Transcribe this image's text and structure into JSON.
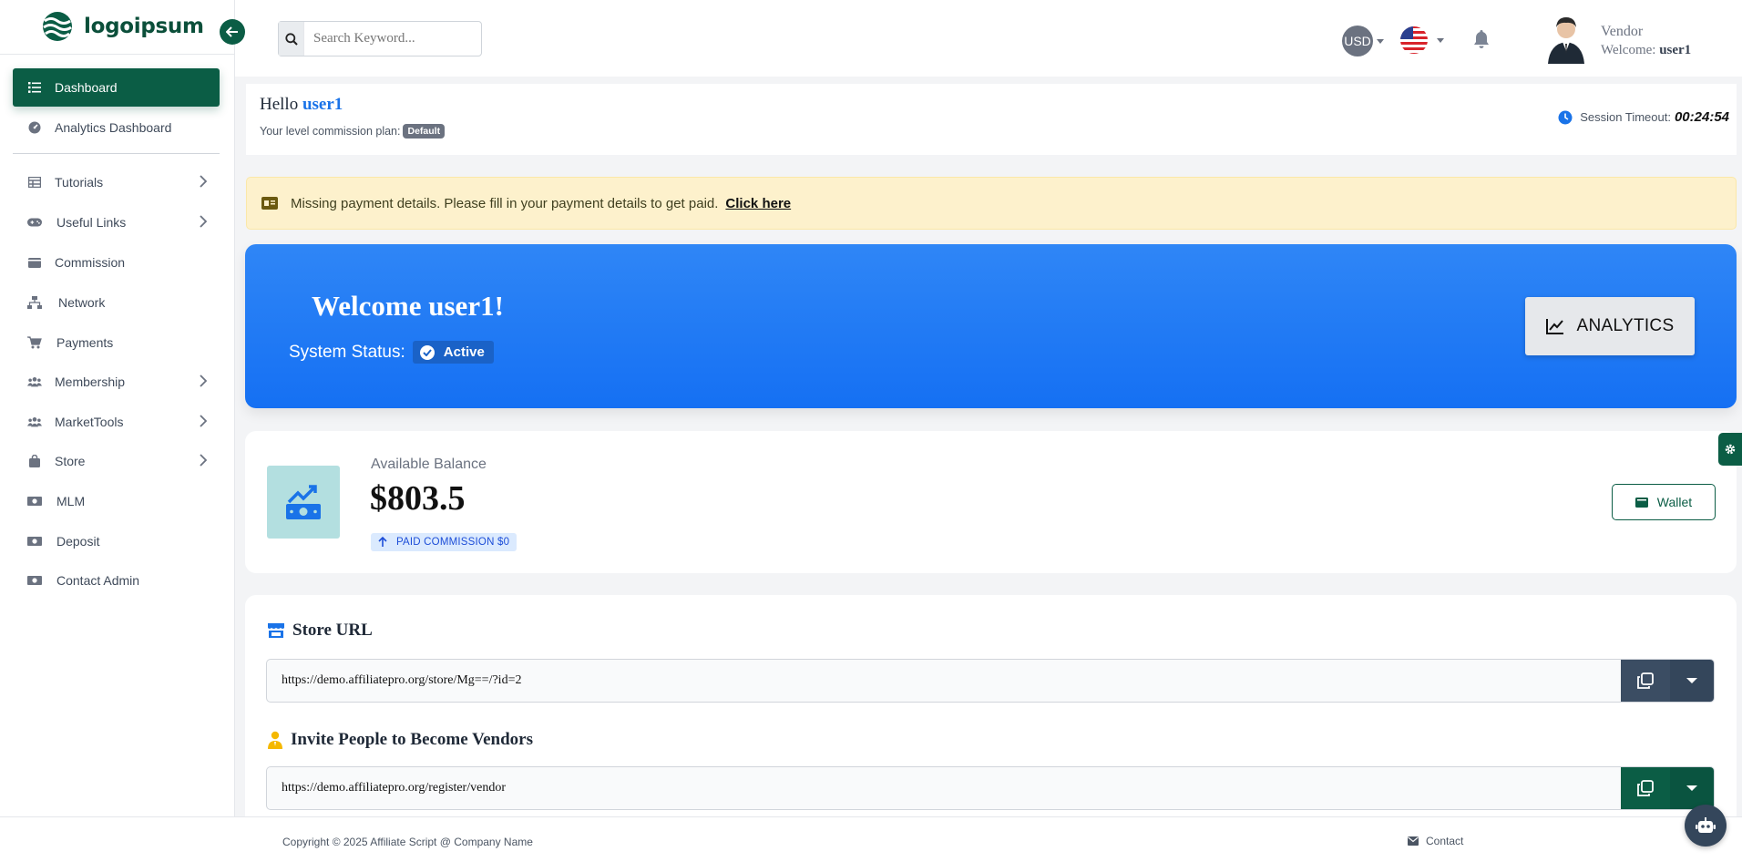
{
  "brand": {
    "name": "logoipsum",
    "accent": "#0b5d45"
  },
  "sidebar": {
    "items": [
      {
        "label": "Dashboard",
        "icon": "list-icon",
        "active": true,
        "has_submenu": false
      },
      {
        "label": "Analytics Dashboard",
        "icon": "gauge-icon",
        "active": false,
        "has_submenu": false
      },
      {
        "label": "Tutorials",
        "icon": "table-icon",
        "active": false,
        "has_submenu": true
      },
      {
        "label": "Useful Links",
        "icon": "gamepad-icon",
        "active": false,
        "has_submenu": true
      },
      {
        "label": "Commission",
        "icon": "wallet-icon",
        "active": false,
        "has_submenu": false
      },
      {
        "label": "Network",
        "icon": "sitemap-icon",
        "active": false,
        "has_submenu": false
      },
      {
        "label": "Payments",
        "icon": "cart-icon",
        "active": false,
        "has_submenu": false
      },
      {
        "label": "Membership",
        "icon": "users-icon",
        "active": false,
        "has_submenu": true
      },
      {
        "label": "MarketTools",
        "icon": "users-icon",
        "active": false,
        "has_submenu": true
      },
      {
        "label": "Store",
        "icon": "bag-icon",
        "active": false,
        "has_submenu": true
      },
      {
        "label": "MLM",
        "icon": "money-icon",
        "active": false,
        "has_submenu": false
      },
      {
        "label": "Deposit",
        "icon": "money-icon",
        "active": false,
        "has_submenu": false
      },
      {
        "label": "Contact Admin",
        "icon": "money-icon",
        "active": false,
        "has_submenu": false
      }
    ]
  },
  "topbar": {
    "search_placeholder": "Search Keyword...",
    "currency": "USD",
    "user_role": "Vendor",
    "welcome_prefix": "Welcome:",
    "username": "user1"
  },
  "hello": {
    "greeting": "Hello",
    "username": "user1",
    "plan_label": "Your level commission plan:",
    "plan_badge": "Default",
    "session_label": "Session Timeout:",
    "session_time": "00:24:54"
  },
  "alert": {
    "message": "Missing payment details. Please fill in your payment details to get paid.",
    "link": "Click here"
  },
  "welcome": {
    "title": "Welcome user1!",
    "status_label": "System Status:",
    "status_value": "Active",
    "analytics_button": "ANALYTICS"
  },
  "balance": {
    "label": "Available Balance",
    "value": "$803.5",
    "paid_commission": "PAID COMMISSION $0",
    "wallet_button": "Wallet"
  },
  "store_url": {
    "title": "Store URL",
    "url": "https://demo.affiliatepro.org/store/Mg==/?id=2"
  },
  "invite": {
    "title": "Invite People to Become Vendors",
    "url": "https://demo.affiliatepro.org/register/vendor"
  },
  "footer": {
    "copyright": "Copyright © 2025 Affiliate Script @ Company Name",
    "contact": "Contact"
  }
}
